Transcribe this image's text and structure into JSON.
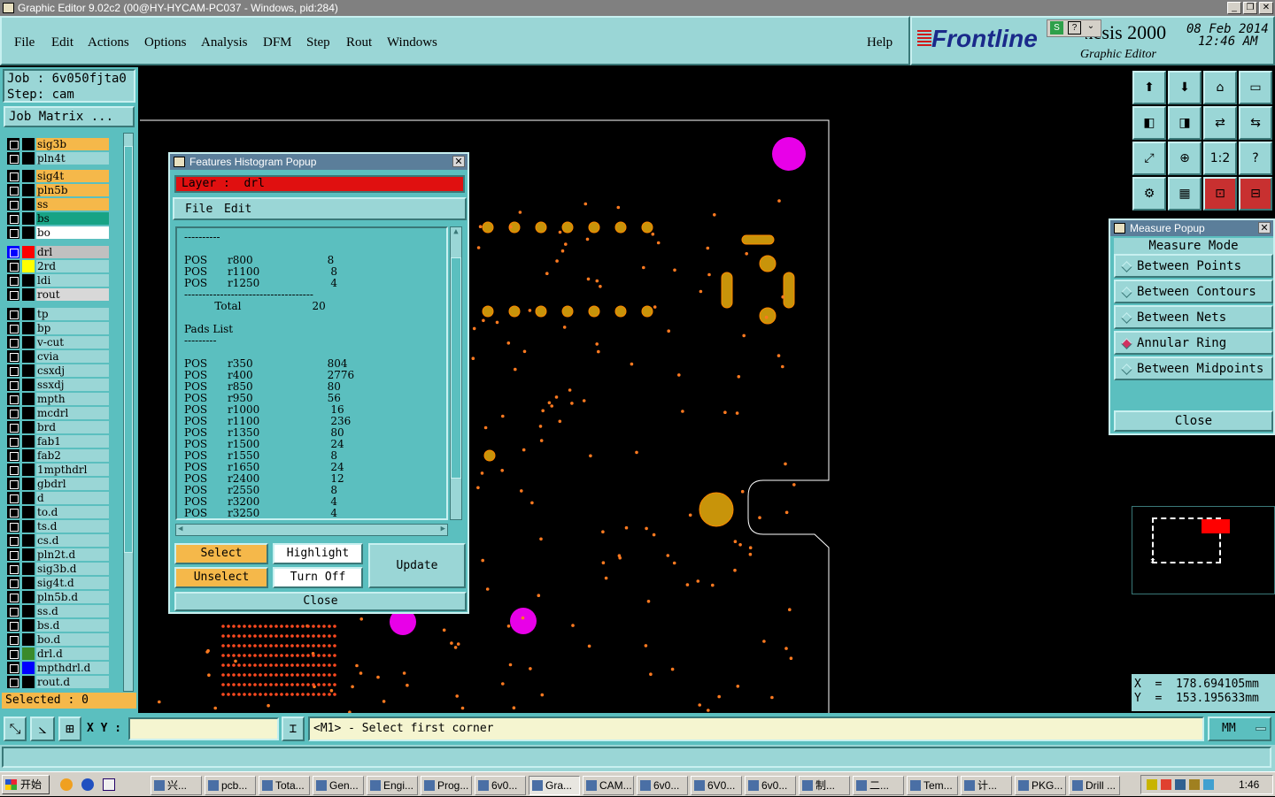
{
  "window": {
    "title": "Graphic Editor 9.02c2 (00@HY-HYCAM-PC037 - Windows, pid:284)"
  },
  "menu": {
    "items": [
      "File",
      "Edit",
      "Actions",
      "Options",
      "Analysis",
      "DFM",
      "Step",
      "Rout",
      "Windows"
    ],
    "help": "Help"
  },
  "brand": {
    "logo": "Frontline",
    "product": "Genesis 2000",
    "subtitle": "Graphic Editor",
    "date": "08 Feb 2014",
    "time": "12:46 AM"
  },
  "job": {
    "job_label": "Job : 6v050fjta0",
    "step_label": "Step: cam",
    "matrix_button": "Job Matrix ..."
  },
  "layers": [
    {
      "name": "sig3b",
      "bg": "#f5b84a",
      "color": "#000000"
    },
    {
      "name": "pln4t",
      "bg": "#9ad6d6",
      "color": "#000000"
    },
    {
      "name": "sig4t",
      "bg": "#f5b84a",
      "color": "#000000"
    },
    {
      "name": "pln5b",
      "bg": "#f5b84a",
      "color": "#000000"
    },
    {
      "name": "ss",
      "bg": "#f5b84a",
      "color": "#000000"
    },
    {
      "name": "bs",
      "bg": "#17a385",
      "color": "#000000"
    },
    {
      "name": "bo",
      "bg": "#ffffff",
      "color": "#000000"
    },
    {
      "name": "drl",
      "bg": "#c0c0c0",
      "color": "#ff0000"
    },
    {
      "name": "2rd",
      "bg": "#9ad6d6",
      "color": "#ffff00"
    },
    {
      "name": "ldi",
      "bg": "#9ad6d6",
      "color": "#000000"
    },
    {
      "name": "rout",
      "bg": "#d8d8d8",
      "color": "#000000"
    },
    {
      "name": "tp",
      "bg": "#9ad6d6",
      "color": "#000000"
    },
    {
      "name": "bp",
      "bg": "#9ad6d6",
      "color": "#000000"
    },
    {
      "name": "v-cut",
      "bg": "#9ad6d6",
      "color": "#000000"
    },
    {
      "name": "cvia",
      "bg": "#9ad6d6",
      "color": "#000000"
    },
    {
      "name": "csxdj",
      "bg": "#9ad6d6",
      "color": "#000000"
    },
    {
      "name": "ssxdj",
      "bg": "#9ad6d6",
      "color": "#000000"
    },
    {
      "name": "mpth",
      "bg": "#9ad6d6",
      "color": "#000000"
    },
    {
      "name": "mcdrl",
      "bg": "#9ad6d6",
      "color": "#000000"
    },
    {
      "name": "brd",
      "bg": "#9ad6d6",
      "color": "#000000"
    },
    {
      "name": "fab1",
      "bg": "#9ad6d6",
      "color": "#000000"
    },
    {
      "name": "fab2",
      "bg": "#9ad6d6",
      "color": "#000000"
    },
    {
      "name": "1mpthdrl",
      "bg": "#9ad6d6",
      "color": "#000000"
    },
    {
      "name": "gbdrl",
      "bg": "#9ad6d6",
      "color": "#000000"
    },
    {
      "name": "d",
      "bg": "#9ad6d6",
      "color": "#000000"
    },
    {
      "name": "to.d",
      "bg": "#9ad6d6",
      "color": "#000000"
    },
    {
      "name": "ts.d",
      "bg": "#9ad6d6",
      "color": "#000000"
    },
    {
      "name": "cs.d",
      "bg": "#9ad6d6",
      "color": "#000000"
    },
    {
      "name": "pln2t.d",
      "bg": "#9ad6d6",
      "color": "#000000"
    },
    {
      "name": "sig3b.d",
      "bg": "#9ad6d6",
      "color": "#000000"
    },
    {
      "name": "sig4t.d",
      "bg": "#9ad6d6",
      "color": "#000000"
    },
    {
      "name": "pln5b.d",
      "bg": "#9ad6d6",
      "color": "#000000"
    },
    {
      "name": "ss.d",
      "bg": "#9ad6d6",
      "color": "#000000"
    },
    {
      "name": "bs.d",
      "bg": "#9ad6d6",
      "color": "#000000"
    },
    {
      "name": "bo.d",
      "bg": "#9ad6d6",
      "color": "#000000"
    },
    {
      "name": "drl.d",
      "bg": "#9ad6d6",
      "color": "#3a8a2a"
    },
    {
      "name": "mpthdrl.d",
      "bg": "#9ad6d6",
      "color": "#0000ff"
    },
    {
      "name": "rout.d",
      "bg": "#9ad6d6",
      "color": "#000000"
    }
  ],
  "selected": "Selected : 0",
  "histogram": {
    "title": "Features Histogram Popup",
    "layer": "Layer :  drl",
    "menu": [
      "File",
      "Edit"
    ],
    "lines": [
      "----------",
      "",
      "POS      r800                      8",
      "POS      r1100                     8",
      "POS      r1250                     4",
      "------------------------------------",
      "         Total                     20",
      "",
      "Pads List",
      "---------",
      "",
      "POS      r350                      804",
      "POS      r400                      2776",
      "POS      r850                      80",
      "POS      r950                      56",
      "POS      r1000                     16",
      "POS      r1100                     236",
      "POS      r1350                     80",
      "POS      r1500                     24",
      "POS      r1550                     8",
      "POS      r1650                     24",
      "POS      r2400                     12",
      "POS      r2550                     8",
      "POS      r3200                     4",
      "POS      r3250                     4"
    ],
    "buttons": {
      "select": "Select",
      "unselect": "Unselect",
      "highlight": "Highlight",
      "turn_off": "Turn Off",
      "update": "Update",
      "close": "Close"
    }
  },
  "measure": {
    "title": "Measure Popup",
    "mode_label": "Measure Mode",
    "options": [
      "Between Points",
      "Between Contours",
      "Between Nets",
      "Annular Ring",
      "Between Midpoints"
    ],
    "selected": "Annular Ring",
    "close": "Close"
  },
  "coords": {
    "x": "X  =  178.694105mm",
    "y": "Y  =  153.195633mm"
  },
  "status": {
    "xy_label": "X Y :",
    "xy_value": "",
    "prompt": "<M1> - Select first corner",
    "units": "MM"
  },
  "taskbar": {
    "start": "开始",
    "tasks": [
      "兴...",
      "pcb...",
      "Tota...",
      "Gen...",
      "Engi...",
      "Prog...",
      "6v0...",
      "Gra...",
      "CAM...",
      "6v0...",
      "6V0...",
      "6v0...",
      "制...",
      "二...",
      "Tem...",
      "计...",
      "PKG...",
      "Drill ..."
    ],
    "clock": "1:46"
  },
  "toolbar_icons": [
    "layer-up-icon",
    "layer-down-icon",
    "home-icon",
    "window-icon",
    "step-left-icon",
    "step-right-icon",
    "swap-icon",
    "swap-alt-icon",
    "zoom-fit-icon",
    "zoom-center-icon",
    "scale-icon",
    "help-icon",
    "settings-icon",
    "grid-icon",
    "snap-icon",
    "snap-alt-icon"
  ]
}
